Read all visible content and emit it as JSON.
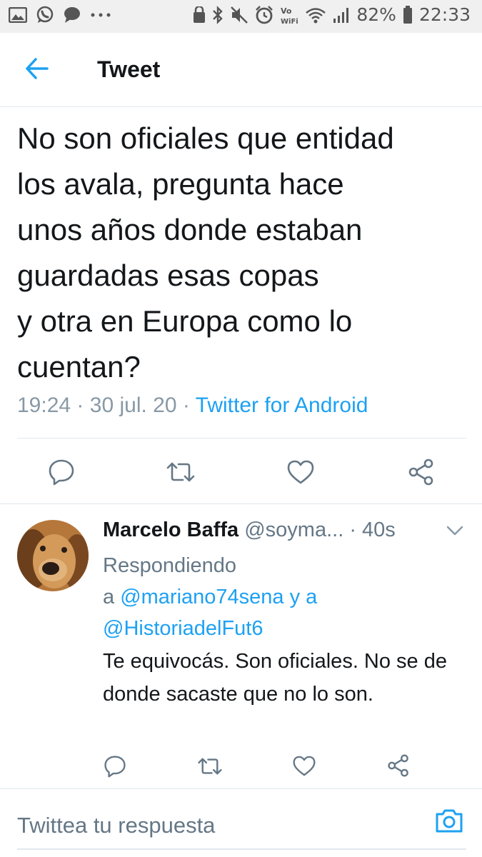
{
  "status_bar": {
    "left_icons": [
      "gallery-icon",
      "whatsapp-icon",
      "chat-icon",
      "more-dots-icon"
    ],
    "right_icons": [
      "secure-folder-icon",
      "bluetooth-icon",
      "mute-icon",
      "alarm-icon",
      "volte-wifi-icon",
      "wifi-icon",
      "signal-icon"
    ],
    "battery": "82%",
    "time": "22:33"
  },
  "header": {
    "back_icon": "arrow-left-icon",
    "title": "Tweet"
  },
  "tweet": {
    "text": "No son oficiales que entidad\nlos avala, pregunta hace\nunos años donde estaban\nguardadas esas copas\ny  otra en Europa como lo\ncuentan?",
    "time": "19:24",
    "sep1": "·",
    "date": "30 jul. 20",
    "sep2": "·",
    "source": "Twitter for Android",
    "actions": [
      "reply-icon",
      "retweet-icon",
      "like-icon",
      "share-icon"
    ]
  },
  "reply": {
    "name": "Marcelo Baffa",
    "handle": "@soyma...",
    "age": "· 40s",
    "replying_label": "Respondiendo",
    "a": "a",
    "mention1": "@mariano74sena",
    "and": "y a",
    "mention2": "@HistoriadelFut6",
    "text": "Te equivocás. Son oficiales. No se de donde sacaste que no lo son.",
    "actions": [
      "reply-icon",
      "retweet-icon",
      "like-icon",
      "share-icon"
    ]
  },
  "composer": {
    "placeholder": "Twittea tu respuesta",
    "camera_icon": "camera-icon"
  },
  "colors": {
    "accent": "#1da1f2",
    "secondary_text": "#657786",
    "meta_text": "#8899a6",
    "divider": "#e1e8ed",
    "statusbar_bg": "#f0f0f0"
  }
}
